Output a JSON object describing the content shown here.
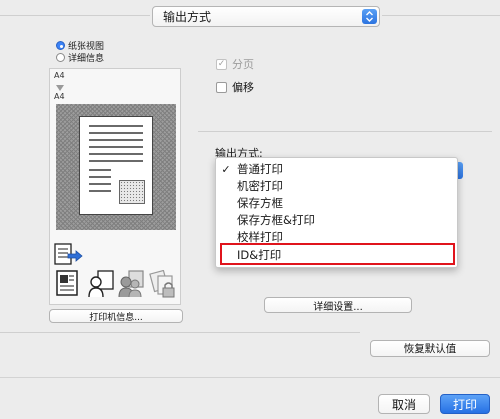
{
  "top_popup": {
    "value": "输出方式"
  },
  "view_options": [
    {
      "label": "纸张视图",
      "selected": true
    },
    {
      "label": "详细信息",
      "selected": false
    }
  ],
  "preview": {
    "paper_from": "A4",
    "paper_to": "A4",
    "printer_info_button": "打印机信息..."
  },
  "options": {
    "collate": {
      "label": "分页",
      "checked": true,
      "enabled": false
    },
    "offset": {
      "label": "偏移",
      "checked": false,
      "enabled": true
    }
  },
  "output_method": {
    "label": "输出方式:",
    "items": [
      {
        "label": "普通打印",
        "checked": true
      },
      {
        "label": "机密打印",
        "checked": false
      },
      {
        "label": "保存方框",
        "checked": false
      },
      {
        "label": "保存方框&打印",
        "checked": false
      },
      {
        "label": "校样打印",
        "checked": false
      },
      {
        "label": "ID&打印",
        "checked": false
      }
    ],
    "highlighted_item": "ID&打印"
  },
  "buttons": {
    "details": "详细设置...",
    "restore_defaults": "恢复默认值",
    "cancel": "取消",
    "print": "打印"
  },
  "colors": {
    "accent": "#2c73e0",
    "highlight_outline": "#e0141c"
  }
}
